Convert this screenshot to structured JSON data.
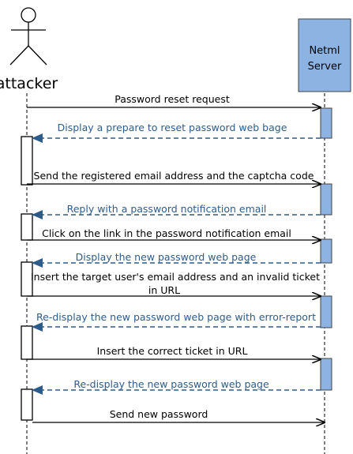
{
  "actor": {
    "label": "attacker"
  },
  "server": {
    "line1": "Netml",
    "line2": "Server"
  },
  "colors": {
    "server_fill": "#8DB3E2",
    "server_stroke": "#404040",
    "activation_fill": "#8DB3E2",
    "reply_color": "#2E5C8A",
    "request_color": "#000000"
  },
  "messages": [
    {
      "text": "Password reset request",
      "kind": "request"
    },
    {
      "text": "Display a prepare to reset password web bage",
      "kind": "reply"
    },
    {
      "text": "Send the registered email address and the captcha code",
      "kind": "request"
    },
    {
      "text": "Reply with a password notification email",
      "kind": "reply"
    },
    {
      "text": "Click on the link in the password notification email",
      "kind": "request"
    },
    {
      "text": "Display the new password web page",
      "kind": "reply"
    },
    {
      "text": "Insert the target user's email address and an invalid ticket",
      "text2": "in URL",
      "kind": "request"
    },
    {
      "text": "Re-display the new password web page with error-report",
      "kind": "reply"
    },
    {
      "text": "Insert the correct ticket in URL",
      "kind": "request"
    },
    {
      "text": "Re-display the new password web page",
      "kind": "reply"
    },
    {
      "text": "Send new password",
      "kind": "request"
    }
  ]
}
